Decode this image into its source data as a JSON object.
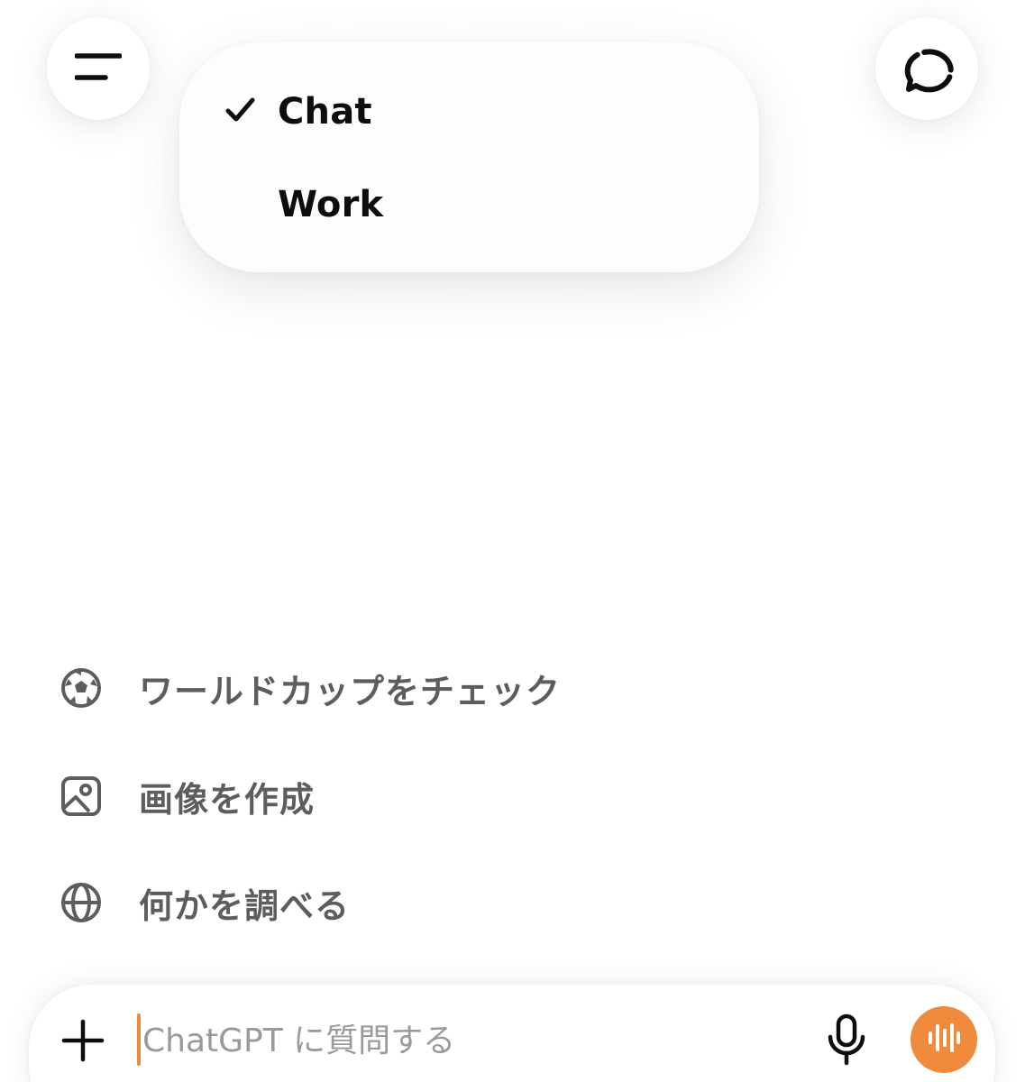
{
  "header": {
    "menu_icon": "hamburger-menu-icon",
    "new_chat_icon": "chat-bubble-icon"
  },
  "mode_menu": {
    "items": [
      {
        "label": "Chat",
        "selected": true
      },
      {
        "label": "Work",
        "selected": false
      }
    ],
    "check_icon": "checkmark-icon"
  },
  "suggestions": [
    {
      "icon": "soccer-ball-icon",
      "label": "ワールドカップをチェック"
    },
    {
      "icon": "image-icon",
      "label": "画像を作成"
    },
    {
      "icon": "globe-icon",
      "label": "何かを調べる"
    }
  ],
  "composer": {
    "value": "",
    "placeholder": "ChatGPT に質問する",
    "plus_icon": "plus-icon",
    "mic_icon": "microphone-icon",
    "voice_icon": "voice-wave-icon"
  },
  "colors": {
    "accent": "#f08a3c",
    "text": "#0d0d0d",
    "muted_text": "#5d5d5d",
    "placeholder": "#9a9a9a",
    "background": "#ffffff"
  }
}
